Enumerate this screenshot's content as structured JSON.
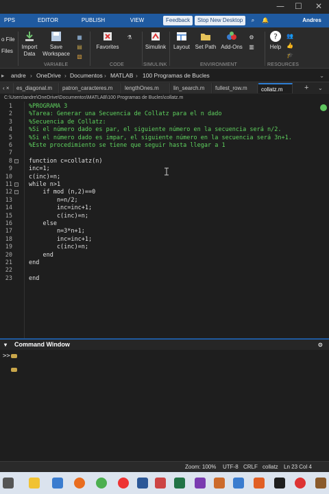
{
  "ribbon_tabs": [
    "PPS",
    "EDITOR",
    "PUBLISH",
    "VIEW"
  ],
  "ribbon_buttons": {
    "feedback": "Feedback",
    "stop_desktop": "Stop New Desktop",
    "user": "Andres"
  },
  "ribbon": {
    "file_a": "o File",
    "file_b": "Files",
    "import": "Import\nData",
    "save": "Save\nWorkspace",
    "favorites": "Favorites",
    "simulink": "Simulink",
    "layout": "Layout",
    "setpath": "Set Path",
    "addons": "Add-Ons",
    "help": "Help",
    "sections": {
      "variable": "VARIABLE",
      "code": "CODE",
      "simulink": "SIMULINK",
      "environment": "ENVIRONMENT",
      "resources": "RESOURCES"
    }
  },
  "breadcrumb": [
    "andre",
    "OneDrive",
    "Documentos",
    "MATLAB",
    "100 Programas de Bucles"
  ],
  "editor_tabs": [
    "es_diagonal.m",
    "patron_caracteres.m",
    "lengthOnes.m",
    "lin_search.m",
    "fullest_row.m",
    "collatz.m"
  ],
  "file_path": "C:\\Users\\andre\\OneDrive\\Documentos\\MATLAB\\100 Programas de Bucles\\collatz.m",
  "code_lines": [
    {
      "n": "1",
      "t": "%PROGRAMA 3",
      "c": true
    },
    {
      "n": "2",
      "t": "%Tarea: Generar una Secuencia de Collatz para el n dado",
      "c": true
    },
    {
      "n": "3",
      "t": "%Secuencia de Collatz:",
      "c": true
    },
    {
      "n": "4",
      "t": "%Si el número dado es par, el siguiente número en la secuencia será n/2.",
      "c": true
    },
    {
      "n": "5",
      "t": "%Si el número dado es impar, el siguiente número en la secuencia será 3n+1.",
      "c": true
    },
    {
      "n": "6",
      "t": "%Este procedimiento se tiene que seguir hasta llegar a 1",
      "c": true
    },
    {
      "n": "7",
      "t": "",
      "c": false
    },
    {
      "n": "8",
      "t": "function c=collatz(n)",
      "c": false
    },
    {
      "n": "9",
      "t": "inc=1;",
      "c": false
    },
    {
      "n": "10",
      "t": "c(inc)=n;",
      "c": false
    },
    {
      "n": "11",
      "t": "while n>1",
      "c": false
    },
    {
      "n": "12",
      "t": "    if mod (n,2)==0",
      "c": false
    },
    {
      "n": "13",
      "t": "        n=n/2;",
      "c": false
    },
    {
      "n": "14",
      "t": "        inc=inc+1;",
      "c": false
    },
    {
      "n": "15",
      "t": "        c(inc)=n;",
      "c": false
    },
    {
      "n": "16",
      "t": "    else",
      "c": false
    },
    {
      "n": "17",
      "t": "        n=3*n+1;",
      "c": false
    },
    {
      "n": "18",
      "t": "        inc=inc+1;",
      "c": false
    },
    {
      "n": "19",
      "t": "        c(inc)=n;",
      "c": false
    },
    {
      "n": "20",
      "t": "    end",
      "c": false
    },
    {
      "n": "21",
      "t": "end",
      "c": false
    },
    {
      "n": "22",
      "t": "",
      "c": false
    },
    {
      "n": "23",
      "t": "end",
      "c": false
    }
  ],
  "command_window": {
    "title": "Command Window",
    "prompt": ">>"
  },
  "status": {
    "zoom": "Zoom: 100%",
    "encoding": "UTF-8",
    "eol": "CRLF",
    "file": "collatz",
    "position": "Ln 23 Col 4"
  }
}
